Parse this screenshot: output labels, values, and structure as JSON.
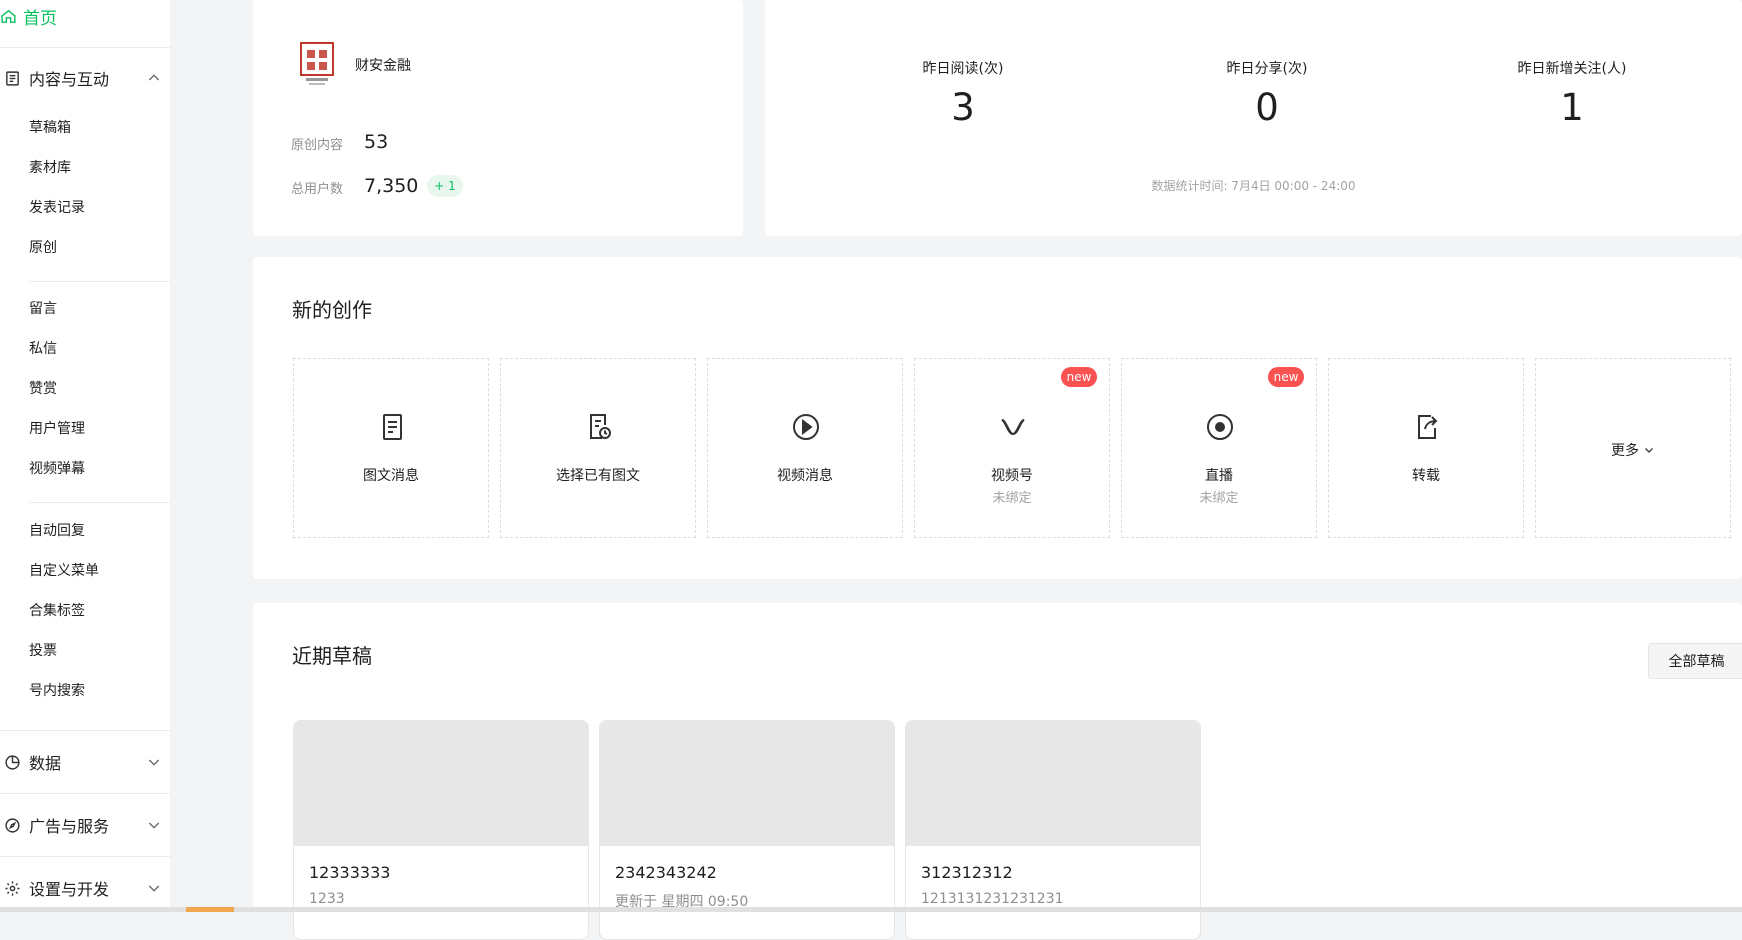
{
  "sidebar": {
    "home": "首页",
    "groups": {
      "content": "内容与互动",
      "data": "数据",
      "ads": "广告与服务",
      "settings": "设置与开发"
    },
    "items": [
      "草稿箱",
      "素材库",
      "发表记录",
      "原创",
      "留言",
      "私信",
      "赞赏",
      "用户管理",
      "视频弹幕",
      "自动回复",
      "自定义菜单",
      "合集标签",
      "投票",
      "号内搜索"
    ]
  },
  "account": {
    "name": "财安金融",
    "original_label": "原创内容",
    "original_value": "53",
    "users_label": "总用户数",
    "users_value": "7,350",
    "users_delta": "+ 1"
  },
  "metrics": {
    "items": [
      {
        "label": "昨日阅读(次)",
        "value": "3"
      },
      {
        "label": "昨日分享(次)",
        "value": "0"
      },
      {
        "label": "昨日新增关注(人)",
        "value": "1"
      }
    ],
    "time_note": "数据统计时间: 7月4日 00:00 - 24:00"
  },
  "create": {
    "title": "新的创作",
    "cards": [
      {
        "label": "图文消息",
        "icon": "document-icon"
      },
      {
        "label": "选择已有图文",
        "icon": "document-clock-icon"
      },
      {
        "label": "视频消息",
        "icon": "play-circle-icon"
      },
      {
        "label": "视频号",
        "sub": "未绑定",
        "badge": "new",
        "icon": "channels-icon"
      },
      {
        "label": "直播",
        "sub": "未绑定",
        "badge": "new",
        "icon": "live-icon"
      },
      {
        "label": "转载",
        "icon": "share-icon"
      }
    ],
    "more": "更多"
  },
  "drafts": {
    "title": "近期草稿",
    "all_button": "全部草稿",
    "items": [
      {
        "title": "12333333",
        "sub": "1233"
      },
      {
        "title": "2342343242",
        "sub": "更新于 星期四 09:50"
      },
      {
        "title": "312312312",
        "sub": "1213131231231231"
      }
    ]
  },
  "colors": {
    "accent": "#07c160",
    "badge": "#fa5151"
  }
}
